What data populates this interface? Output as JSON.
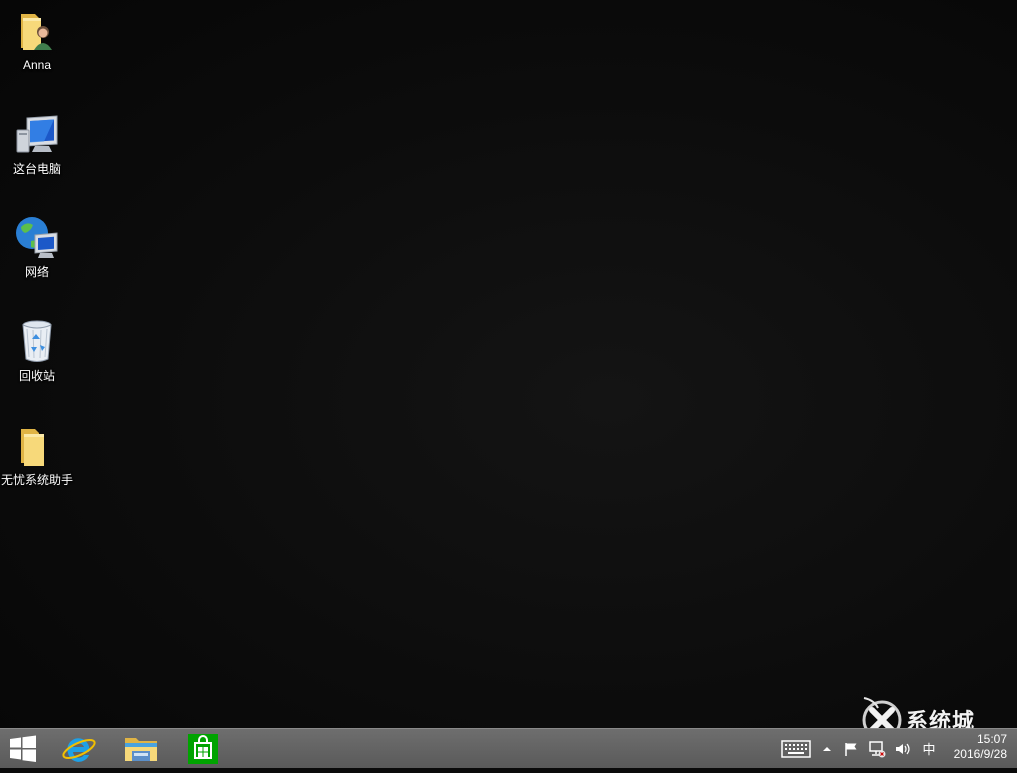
{
  "desktop": {
    "icons": [
      {
        "label": "Anna",
        "icon": "user-folder-icon"
      },
      {
        "label": "这台电脑",
        "icon": "computer-icon"
      },
      {
        "label": "网络",
        "icon": "network-icon"
      },
      {
        "label": "回收站",
        "icon": "recycle-bin-icon"
      },
      {
        "label": "无忧系统助手",
        "icon": "folder-icon"
      }
    ]
  },
  "taskbar": {
    "pinned": [
      {
        "name": "start",
        "icon": "windows-logo-icon"
      },
      {
        "name": "internet-explorer",
        "icon": "internet-explorer-icon"
      },
      {
        "name": "file-explorer",
        "icon": "file-explorer-icon"
      },
      {
        "name": "store",
        "icon": "store-icon"
      }
    ],
    "tray": {
      "ime_label": "中",
      "time": "15:07",
      "date": "2016/9/28"
    }
  },
  "watermark": {
    "text": "系统城"
  },
  "colors": {
    "taskbar": "#616161",
    "store_green": "#00a300",
    "ie_blue": "#1ea0e6",
    "folder_yellow": "#f2cd63"
  }
}
